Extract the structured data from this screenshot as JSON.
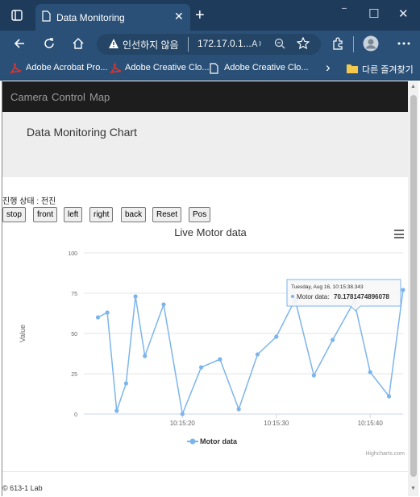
{
  "browser": {
    "tab_title": "Data Monitoring",
    "tab_close_glyph": "✕",
    "new_tab_glyph": "+",
    "window_controls": [
      "⁻",
      "☐",
      "✕"
    ],
    "security_label": "인선하지 않음",
    "url": "172.17.0.1...",
    "bookmarks": [
      "Adobe Acrobat Pro...",
      "Adobe Creative Clo...",
      "Adobe Creative Clo..."
    ],
    "bookmarks_folder": "다른 즐겨찾기",
    "chevron_glyph": "›",
    "colors": {
      "tabbar": "#1f3b5c",
      "toolbar": "#2a5077"
    },
    "icons": [
      "tab-actions-icon",
      "page-icon",
      "back-icon",
      "refresh-icon",
      "home-icon",
      "warning-icon",
      "read-aloud-icon",
      "zoom-icon",
      "favorites-add-icon",
      "extensions-icon",
      "profile-icon",
      "settings-more-icon",
      "acrobat-icon",
      "folder-icon"
    ]
  },
  "nav": {
    "items": [
      "Camera",
      "Control",
      "Map"
    ]
  },
  "header": {
    "title": "Data Monitoring Chart"
  },
  "status": {
    "text": "진행 상태 : 전진"
  },
  "controls": [
    "stop",
    "front",
    "left",
    "right",
    "back",
    "Reset",
    "Pos"
  ],
  "chart_data": {
    "type": "line",
    "title": "Live Motor data",
    "ylabel": "Value",
    "ylim": [
      0,
      100
    ],
    "yticks": [
      "0",
      "25",
      "50",
      "75",
      "100"
    ],
    "xticks": [
      "10:15:20",
      "10:15:30",
      "10:15:40"
    ],
    "x_seconds_ticks": [
      20,
      30,
      40
    ],
    "series": [
      {
        "name": "Motor data",
        "color": "#7cb5ec",
        "x": [
          11.0,
          12.0,
          13.0,
          14.0,
          15.0,
          16.0,
          18.0,
          20.0,
          22.0,
          24.0,
          26.0,
          28.0,
          30.0,
          32.0,
          34.0,
          36.0,
          38.3,
          40.0,
          42.0,
          43.5
        ],
        "values": [
          60,
          63,
          2,
          19,
          73,
          36,
          68,
          0,
          29,
          34,
          3,
          37,
          48,
          71,
          24,
          46,
          70,
          26,
          11,
          77
        ]
      }
    ],
    "tooltip": {
      "date": "Tuesday, Aug 16, 10:15:38.343",
      "series_label": "Motor data:",
      "value": "70.1781474896078"
    },
    "credits": "Highcharts.com",
    "legend_position": "bottom-center",
    "grid": true
  },
  "footer": {
    "text": "© 613-1 Lab"
  }
}
